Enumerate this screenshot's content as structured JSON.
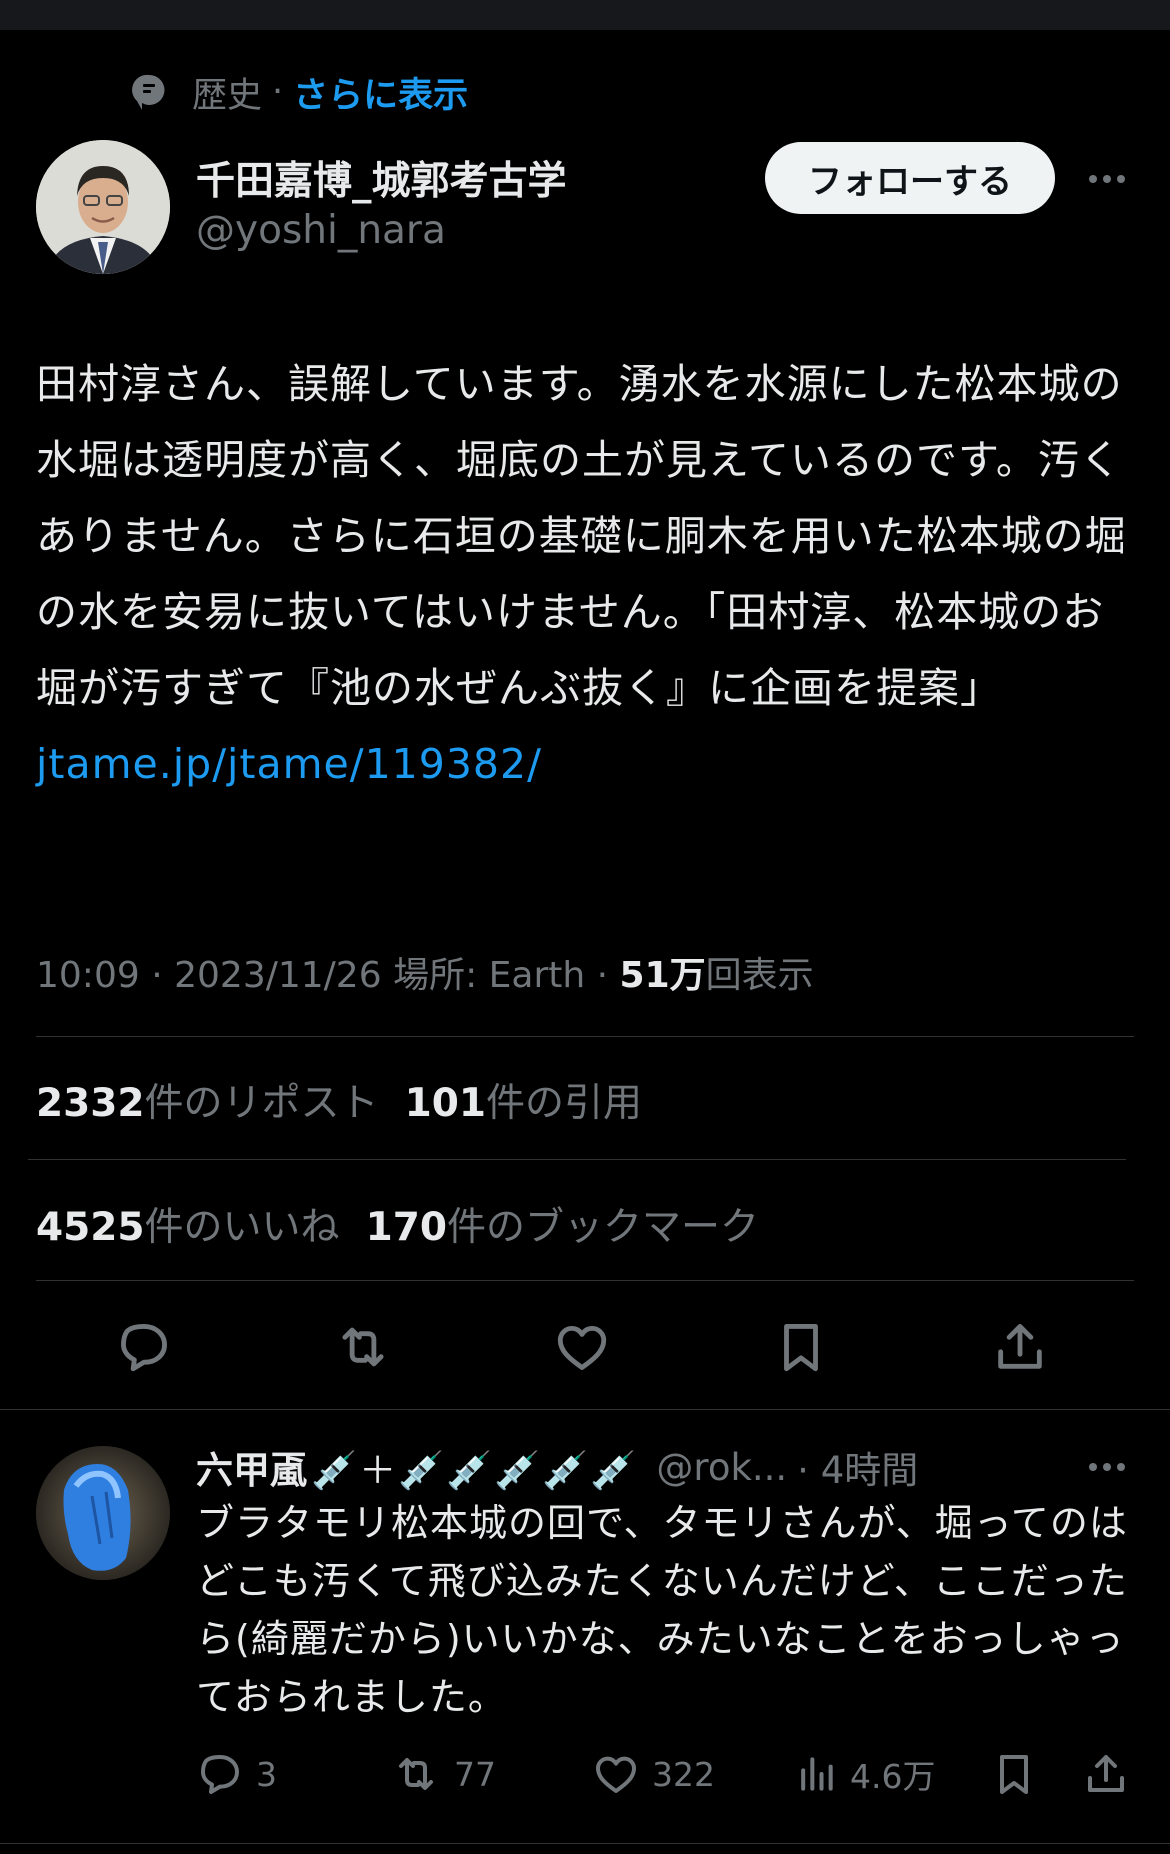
{
  "topic": {
    "category": "歴史",
    "separator": "·",
    "show_more": "さらに表示"
  },
  "author": {
    "name": "千田嘉博_城郭考古学",
    "handle": "@yoshi_nara",
    "follow_label": "フォローする"
  },
  "post": {
    "text": "田村淳さん、誤解しています。湧水を水源にした松本城の水堀は透明度が高く、堀底の土が見えているのです。汚くありません。さらに石垣の基礎に胴木を用いた松本城の堀の水を安易に抜いてはいけません。「田村淳、松本城のお堀が汚すぎて『池の水ぜんぶ抜く』に企画を提案」",
    "link": "jtame.jp/jtame/119382/"
  },
  "meta": {
    "time": "10:09",
    "date": "2023/11/26",
    "location": "場所: Earth",
    "views_count": "51万",
    "views_label": "回表示",
    "sep": "·"
  },
  "stats": {
    "reposts_count": "2332",
    "reposts_label": "件のリポスト",
    "quotes_count": "101",
    "quotes_label": "件の引用",
    "likes_count": "4525",
    "likes_label": "件のいいね",
    "bookmarks_count": "170",
    "bookmarks_label": "件のブックマーク"
  },
  "actions": [
    "reply-icon",
    "repost-icon",
    "like-icon",
    "bookmark-icon",
    "share-icon"
  ],
  "reply": {
    "name": "六甲颪",
    "emoji": "💉＋💉💉💉💉💉",
    "handle": "@rok...",
    "time": "· 4時間",
    "text": "ブラタモリ松本城の回で、タモリさんが、堀ってのはどこも汚くて飛び込みたくないんだけど、ここだったら(綺麗だから)いいかな、みたいなことをおっしゃっておられました。",
    "replies": "3",
    "reposts": "77",
    "likes": "322",
    "views": "4.6万"
  },
  "colors": {
    "background": "#000000",
    "text": "#e7e9ea",
    "muted": "#71767b",
    "accent": "#1d9bf0",
    "divider": "#2f3336"
  }
}
